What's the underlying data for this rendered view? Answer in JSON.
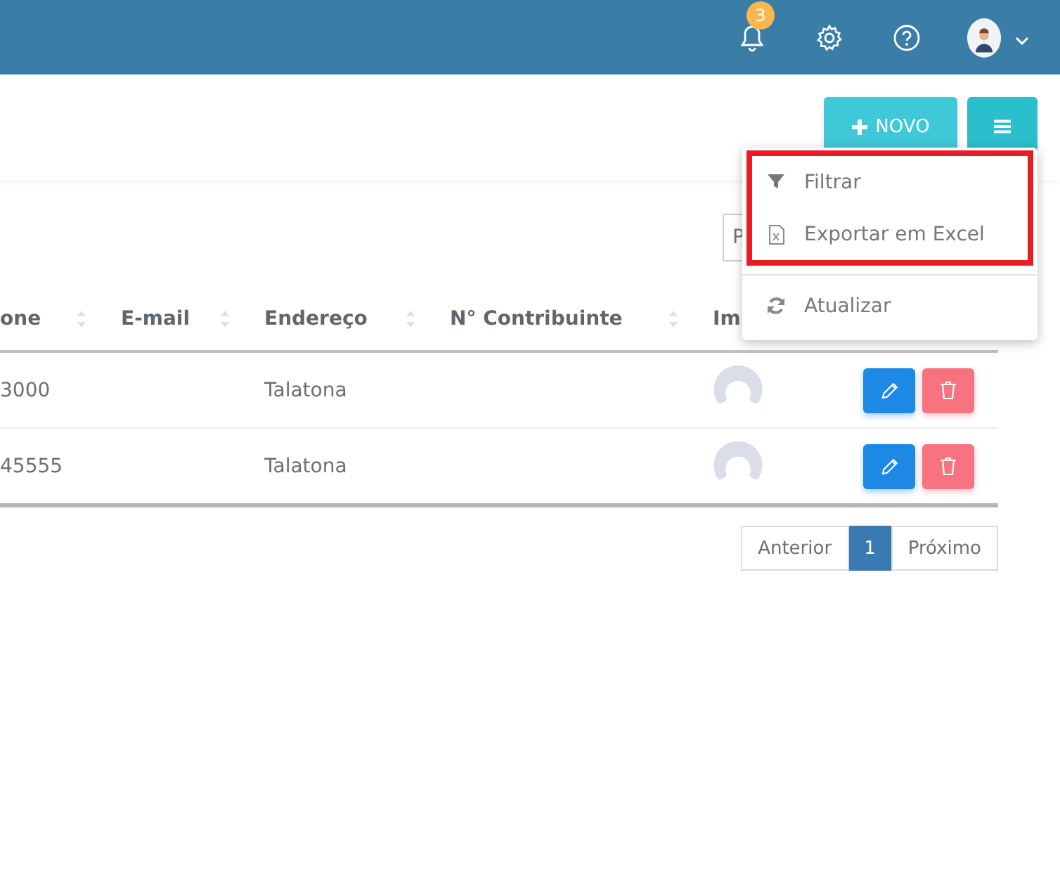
{
  "topbar": {
    "notification_count": "3"
  },
  "toolbar": {
    "new_button": "NOVO"
  },
  "search": {
    "placeholder": "P"
  },
  "table": {
    "columns": [
      {
        "label": "one",
        "sortable": true
      },
      {
        "label": "E-mail",
        "sortable": true
      },
      {
        "label": "Endereço",
        "sortable": true
      },
      {
        "label": "N° Contribuinte",
        "sortable": true
      },
      {
        "label": "Im",
        "sortable": false
      }
    ],
    "rows": [
      {
        "column_1": "3000",
        "address": "Talatona"
      },
      {
        "column_1": "45555",
        "address": "Talatona"
      }
    ]
  },
  "pagination": {
    "previous": "Anterior",
    "pages": [
      {
        "label": "1",
        "selected": true
      }
    ],
    "next": "Próximo"
  },
  "dropdown": {
    "items": [
      {
        "kind": "filter",
        "label": "Filtrar",
        "highlighted": true
      },
      {
        "kind": "excel",
        "label": "Exportar em Excel",
        "highlighted": true
      },
      {
        "kind": "refresh",
        "label": "Atualizar",
        "highlighted": false
      }
    ]
  }
}
